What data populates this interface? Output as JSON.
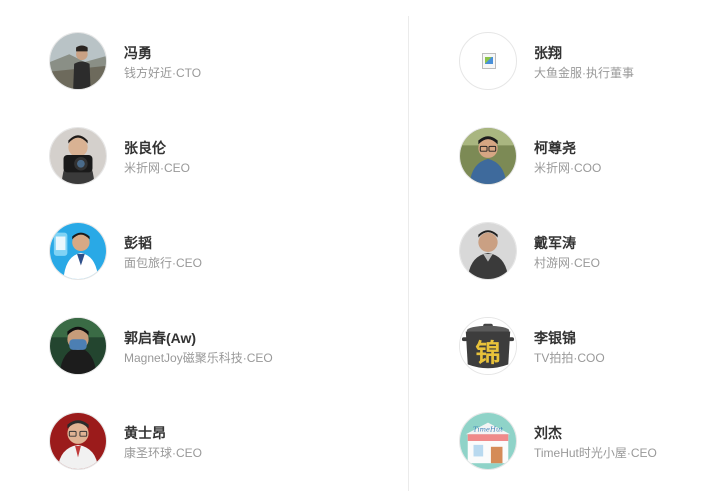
{
  "left_column": [
    {
      "name": "冯勇",
      "title": "钱方好近·CTO",
      "avatar": "photo-outdoor-man"
    },
    {
      "name": "张良伦",
      "title": "米折网·CEO",
      "avatar": "photo-camera-man"
    },
    {
      "name": "彭韬",
      "title": "面包旅行·CEO",
      "avatar": "photo-blue-app-man"
    },
    {
      "name": "郭启春(Aw)",
      "title": "MagnetJoy磁聚乐科技·CEO",
      "avatar": "photo-masked-man"
    },
    {
      "name": "黄士昂",
      "title": "康圣环球·CEO",
      "avatar": "photo-glasses-man-red"
    }
  ],
  "right_column": [
    {
      "name": "张翔",
      "title": "大鱼金服·执行董事",
      "avatar": "broken-image-icon"
    },
    {
      "name": "柯尊尧",
      "title": "米折网·COO",
      "avatar": "photo-glasses-man-park"
    },
    {
      "name": "戴军涛",
      "title": "村游网·CEO",
      "avatar": "photo-man-dark-jacket"
    },
    {
      "name": "李银锦",
      "title": "TV拍拍·COO",
      "avatar": "pot-logo-锦"
    },
    {
      "name": "刘杰",
      "title": "TimeHut时光小屋·CEO",
      "avatar": "timehut-logo"
    }
  ],
  "logo_text": {
    "pot": "锦",
    "timehut": "TimeHut"
  }
}
